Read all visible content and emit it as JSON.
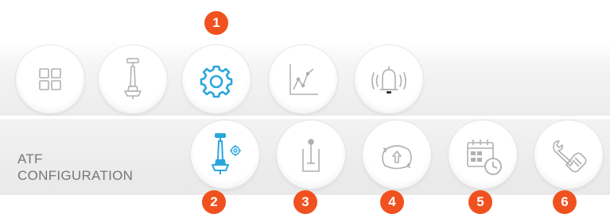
{
  "colors": {
    "accent_blue": "#2aa6dc",
    "badge_orange": "#f0511e",
    "icon_gray": "#b0b0b0",
    "label_gray": "#777777"
  },
  "toolbar_top": [
    {
      "icon": "grid-icon",
      "active": false
    },
    {
      "icon": "probe-icon",
      "active": false
    },
    {
      "icon": "gear-icon",
      "active": true
    },
    {
      "icon": "line-chart-icon",
      "active": false
    },
    {
      "icon": "alarm-bell-icon",
      "active": false
    }
  ],
  "section": {
    "label_line1": "ATF",
    "label_line2": "CONFIGURATION"
  },
  "toolbar_bottom": [
    {
      "icon": "probe-settings-icon",
      "active": true
    },
    {
      "icon": "tank-mixer-icon",
      "active": false
    },
    {
      "icon": "upload-cycle-icon",
      "active": false
    },
    {
      "icon": "calendar-clock-icon",
      "active": false
    },
    {
      "icon": "wrench-hand-icon",
      "active": false
    }
  ],
  "badges": [
    "1",
    "2",
    "3",
    "4",
    "5",
    "6"
  ]
}
